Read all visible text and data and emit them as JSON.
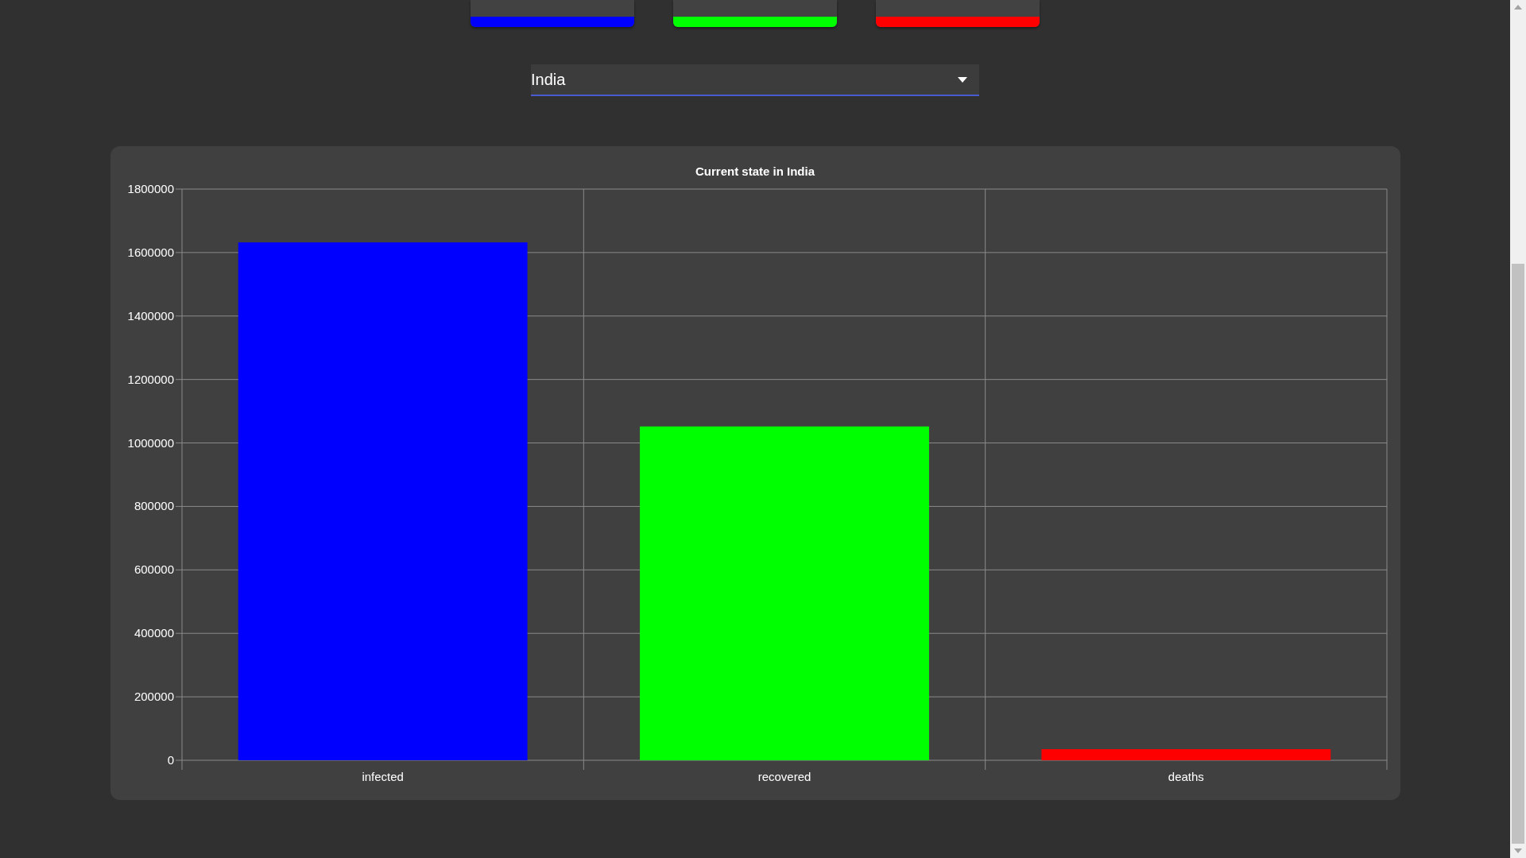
{
  "summary_cards": [
    {
      "color": "#0000ff"
    },
    {
      "color": "#00ff00"
    },
    {
      "color": "#ff0000"
    }
  ],
  "country_select": {
    "value": "India"
  },
  "chart": {
    "chart_data": {
      "type": "bar",
      "title": "Current state in India",
      "categories": [
        "infected",
        "recovered",
        "deaths"
      ],
      "grid": true,
      "series": [
        {
          "colors": [
            "#0000ff",
            "#00ff00",
            "#ff0000"
          ],
          "values": [
            1632000,
            1052000,
            35000
          ]
        }
      ],
      "ylim": [
        0,
        1800000
      ],
      "yticks": [
        0,
        200000,
        400000,
        600000,
        800000,
        1000000,
        1200000,
        1400000,
        1600000,
        1800000
      ]
    }
  }
}
